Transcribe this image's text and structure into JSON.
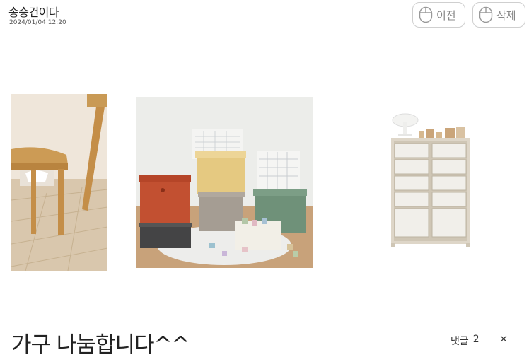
{
  "post": {
    "author": "송승건이다",
    "datetime": "2024/01/04 12:20",
    "title": "가구 나눔합니다^^"
  },
  "actions": {
    "prev_label": "이전",
    "delete_label": "삭제"
  },
  "comments": {
    "label": "댓글",
    "count": "2"
  },
  "close_glyph": "×",
  "icons": {
    "prev": "mouse-icon",
    "delete": "mouse-icon",
    "close": "close-icon"
  },
  "photos": [
    {
      "name": "wooden-stool-photo"
    },
    {
      "name": "storage-boxes-photo"
    },
    {
      "name": "toy-organizer-shelf-photo"
    }
  ],
  "colors": {
    "text": "#222222",
    "muted": "#888888",
    "border": "#cfcfcf"
  }
}
